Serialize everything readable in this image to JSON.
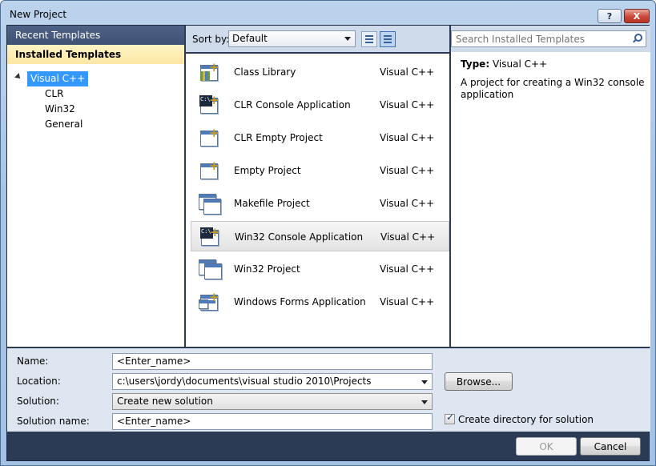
{
  "window": {
    "title": "New Project",
    "help_label": "?",
    "close_label": "X"
  },
  "left_panel": {
    "recent_label": "Recent Templates",
    "installed_label": "Installed Templates",
    "tree": {
      "root": "Visual C++",
      "children": [
        "CLR",
        "Win32",
        "General"
      ]
    }
  },
  "sort": {
    "label": "Sort by:",
    "value": "Default"
  },
  "search": {
    "placeholder": "Search Installed Templates"
  },
  "templates": [
    {
      "name": "Class Library",
      "lang": "Visual C++",
      "icon": "class-library-icon"
    },
    {
      "name": "CLR Console Application",
      "lang": "Visual C++",
      "icon": "console-app-icon"
    },
    {
      "name": "CLR Empty Project",
      "lang": "Visual C++",
      "icon": "empty-project-icon"
    },
    {
      "name": "Empty Project",
      "lang": "Visual C++",
      "icon": "empty-project-icon"
    },
    {
      "name": "Makefile Project",
      "lang": "Visual C++",
      "icon": "makefile-icon"
    },
    {
      "name": "Win32 Console Application",
      "lang": "Visual C++",
      "icon": "console-app-icon",
      "selected": true
    },
    {
      "name": "Win32 Project",
      "lang": "Visual C++",
      "icon": "window-app-icon"
    },
    {
      "name": "Windows Forms Application",
      "lang": "Visual C++",
      "icon": "forms-app-icon"
    }
  ],
  "info": {
    "type_label": "Type:",
    "type_value": "Visual C++",
    "description": "A project for creating a Win32 console application"
  },
  "form": {
    "name_label": "Name:",
    "name_value": "<Enter_name>",
    "location_label": "Location:",
    "location_value": "c:\\users\\jordy\\documents\\visual studio 2010\\Projects",
    "browse_label": "Browse...",
    "solution_label": "Solution:",
    "solution_value": "Create new solution",
    "solution_name_label": "Solution name:",
    "solution_name_value": "<Enter_name>",
    "create_dir_label": "Create directory for solution",
    "create_dir_checked": true
  },
  "buttons": {
    "ok": "OK",
    "cancel": "Cancel"
  }
}
